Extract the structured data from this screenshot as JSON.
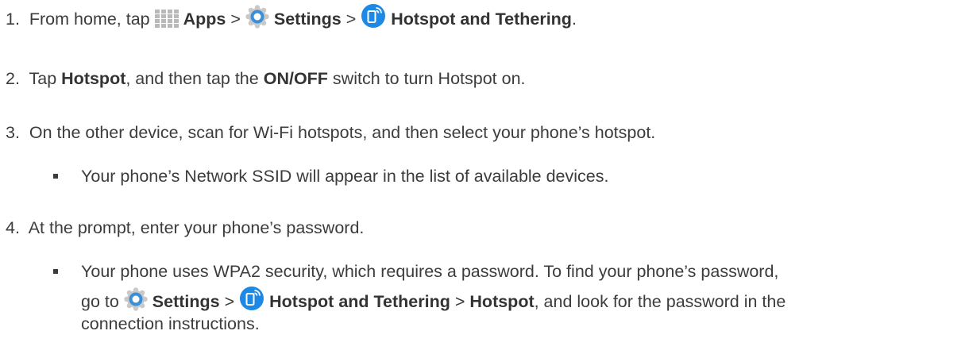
{
  "steps": [
    {
      "number": "1.",
      "parts": {
        "t1": "From home, tap",
        "apps": "Apps",
        "sep1": ">",
        "settings": "Settings",
        "sep2": ">",
        "hotspot_tethering": "Hotspot and Tethering",
        "end": "."
      }
    },
    {
      "number": "2.",
      "parts": {
        "t1": "Tap",
        "hotspot": "Hotspot",
        "t2": ", and then tap the",
        "onoff": "ON/OFF",
        "t3": "switch to turn Hotspot on."
      }
    },
    {
      "number": "3.",
      "text": "On the other device, scan for Wi-Fi hotspots, and then select your phone’s hotspot.",
      "bullet": "Your phone’s Network SSID will appear in the list of available devices."
    },
    {
      "number": "4.",
      "text": "At the prompt, enter your phone’s password.",
      "bullet": {
        "line1": "Your phone uses WPA2 security, which requires a password. To find your phone’s password,",
        "l2_go": "go to",
        "l2_settings": "Settings",
        "l2_sep1": ">",
        "l2_hotspot_tethering": "Hotspot and Tethering",
        "l2_sep2": ">",
        "l2_hotspot": "Hotspot",
        "l2_end": ", and look for the password in the",
        "line3": "connection instructions."
      }
    }
  ],
  "icons": {
    "apps": "apps-grid-icon",
    "settings": "settings-gear-icon",
    "hotspot": "hotspot-tethering-icon"
  },
  "colors": {
    "text": "#3c3c3c",
    "settings_icon": "#3a8fd6",
    "hotspot_icon": "#1e88e5"
  }
}
